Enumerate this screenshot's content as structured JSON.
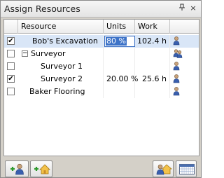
{
  "window": {
    "title": "Assign Resources",
    "pin_glyph": "ᵖ",
    "close_glyph": "×"
  },
  "grid": {
    "headers": {
      "resource": "Resource",
      "units": "Units",
      "work": "Work"
    },
    "rows": [
      {
        "resource": "Bob's Excavation",
        "units": "80 %",
        "work": "102.4 h",
        "checked": true,
        "selected": true,
        "icon": "person-icon"
      },
      {
        "resource": "Surveyor",
        "units": "",
        "work": "",
        "checked": false,
        "expander": "−",
        "icon": "group-icon"
      },
      {
        "resource": "Surveyor 1",
        "units": "",
        "work": "",
        "checked": false,
        "icon": "person-icon"
      },
      {
        "resource": "Surveyor 2",
        "units": "20.00 %",
        "work": "25.6 h",
        "checked": true,
        "icon": "person-icon"
      },
      {
        "resource": "Baker Flooring",
        "units": "",
        "work": "",
        "checked": false,
        "icon": "person-icon"
      }
    ]
  },
  "toolbar": {
    "left": [
      "add-resource-icon",
      "add-team-icon"
    ],
    "right": [
      "replace-resource-icon",
      "calendar-icon"
    ]
  },
  "colors": {
    "selection": "#d9e6f7",
    "edit_highlight": "#3d73c8"
  }
}
